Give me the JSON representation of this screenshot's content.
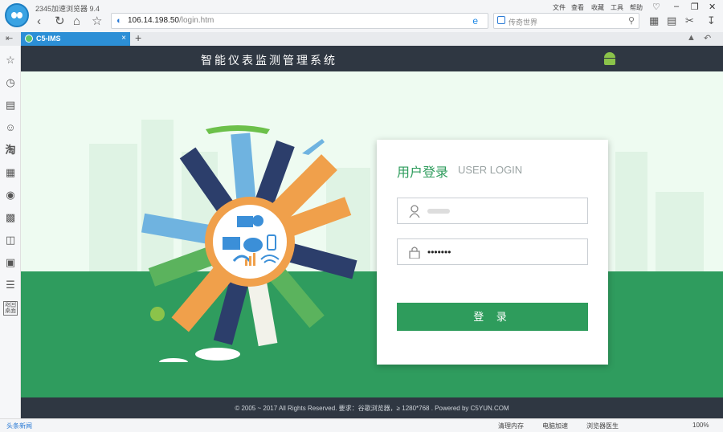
{
  "browser": {
    "app_title": "2345加速浏览器 9.4",
    "url_host": "106.14.198.50",
    "url_path": "/login.htm",
    "search_placeholder": "传奇世界",
    "menu": [
      "文件",
      "查看",
      "收藏",
      "工具",
      "帮助"
    ],
    "tab_title": "C5-IMS",
    "sidebar_icons": [
      "star-icon",
      "history-icon",
      "news-icon",
      "wechat-icon",
      "taobao-icon",
      "calendar-icon",
      "game-icon",
      "video-icon",
      "tv-icon",
      "save-icon",
      "list-icon"
    ],
    "sidebar_bottom_label": "返回桌面"
  },
  "page": {
    "system_title": "智能仪表监测管理系统",
    "login": {
      "title_cn": "用户登录",
      "title_en": "USER LOGIN",
      "password_mask": "•••••••",
      "button": "登 录"
    },
    "footer": "© 2005 ~ 2017 All Rights Reserved. 要求：谷歌浏览器，≥ 1280*768 . Powered by C5YUN.COM"
  },
  "status": {
    "news": "头条新闻",
    "items": [
      "清理内存",
      "电脑加速",
      "浏览器医生"
    ],
    "zoom": "100%"
  },
  "colors": {
    "accent": "#2e9c5c",
    "header": "#2f3742",
    "tab": "#2c8fd6"
  }
}
